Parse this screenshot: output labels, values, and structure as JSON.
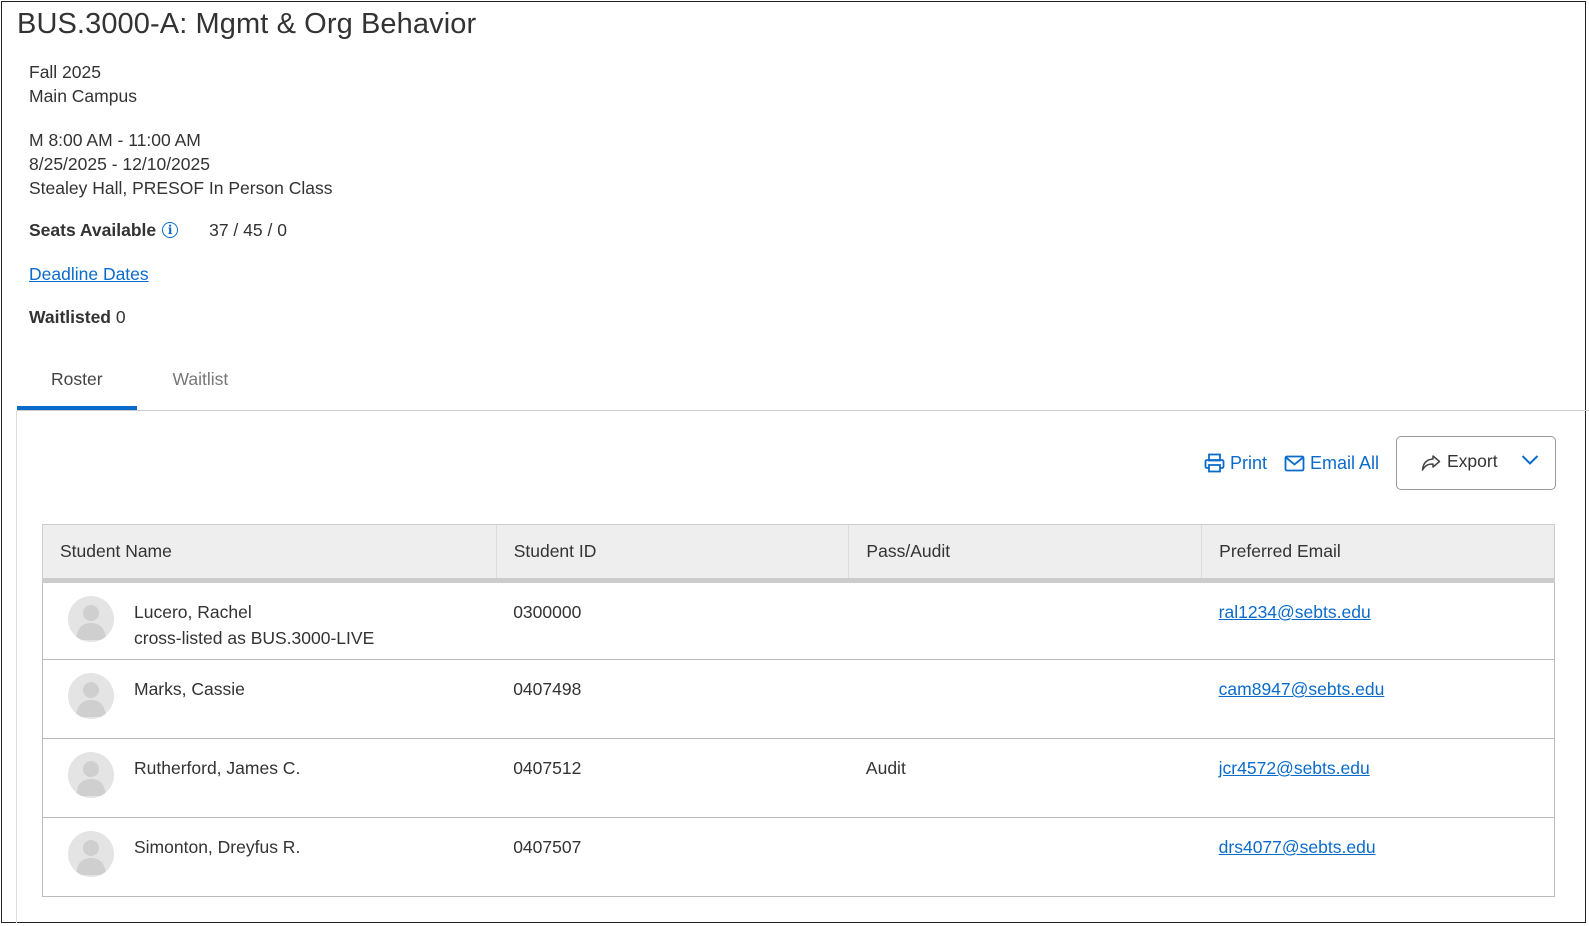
{
  "course": {
    "title": "BUS.3000-A: Mgmt & Org Behavior",
    "term": "Fall 2025",
    "campus": "Main Campus",
    "meeting_time": "M 8:00 AM - 11:00 AM",
    "date_range": "8/25/2025 - 12/10/2025",
    "location": "Stealey Hall, PRESOF In Person Class",
    "seats_label": "Seats Available",
    "seats_value": "37 / 45 / 0",
    "deadline_link": "Deadline Dates",
    "waitlisted_label": "Waitlisted",
    "waitlisted_value": "0"
  },
  "tabs": [
    {
      "label": "Roster",
      "active": true
    },
    {
      "label": "Waitlist",
      "active": false
    }
  ],
  "actions": {
    "print": "Print",
    "email_all": "Email All",
    "export": "Export"
  },
  "table": {
    "headers": [
      "Student Name",
      "Student ID",
      "Pass/Audit",
      "Preferred Email"
    ],
    "rows": [
      {
        "name": "Lucero, Rachel",
        "note": "cross-listed as BUS.3000-LIVE",
        "id": "0300000",
        "pass_audit": "",
        "email": "ral1234@sebts.edu"
      },
      {
        "name": "Marks, Cassie",
        "note": "",
        "id": "0407498",
        "pass_audit": "",
        "email": "cam8947@sebts.edu"
      },
      {
        "name": "Rutherford, James C.",
        "note": "",
        "id": "0407512",
        "pass_audit": "Audit",
        "email": "jcr4572@sebts.edu"
      },
      {
        "name": "Simonton, Dreyfus R.",
        "note": "",
        "id": "0407507",
        "pass_audit": "",
        "email": "drs4077@sebts.edu"
      }
    ]
  },
  "colors": {
    "accent": "#0b6bcb",
    "header_bg": "#eeeeee",
    "avatar_bg": "#e4e4e4"
  },
  "icons": [
    "info-icon",
    "print-icon",
    "mail-icon",
    "share-icon",
    "chevron-down-icon",
    "avatar-icon"
  ]
}
